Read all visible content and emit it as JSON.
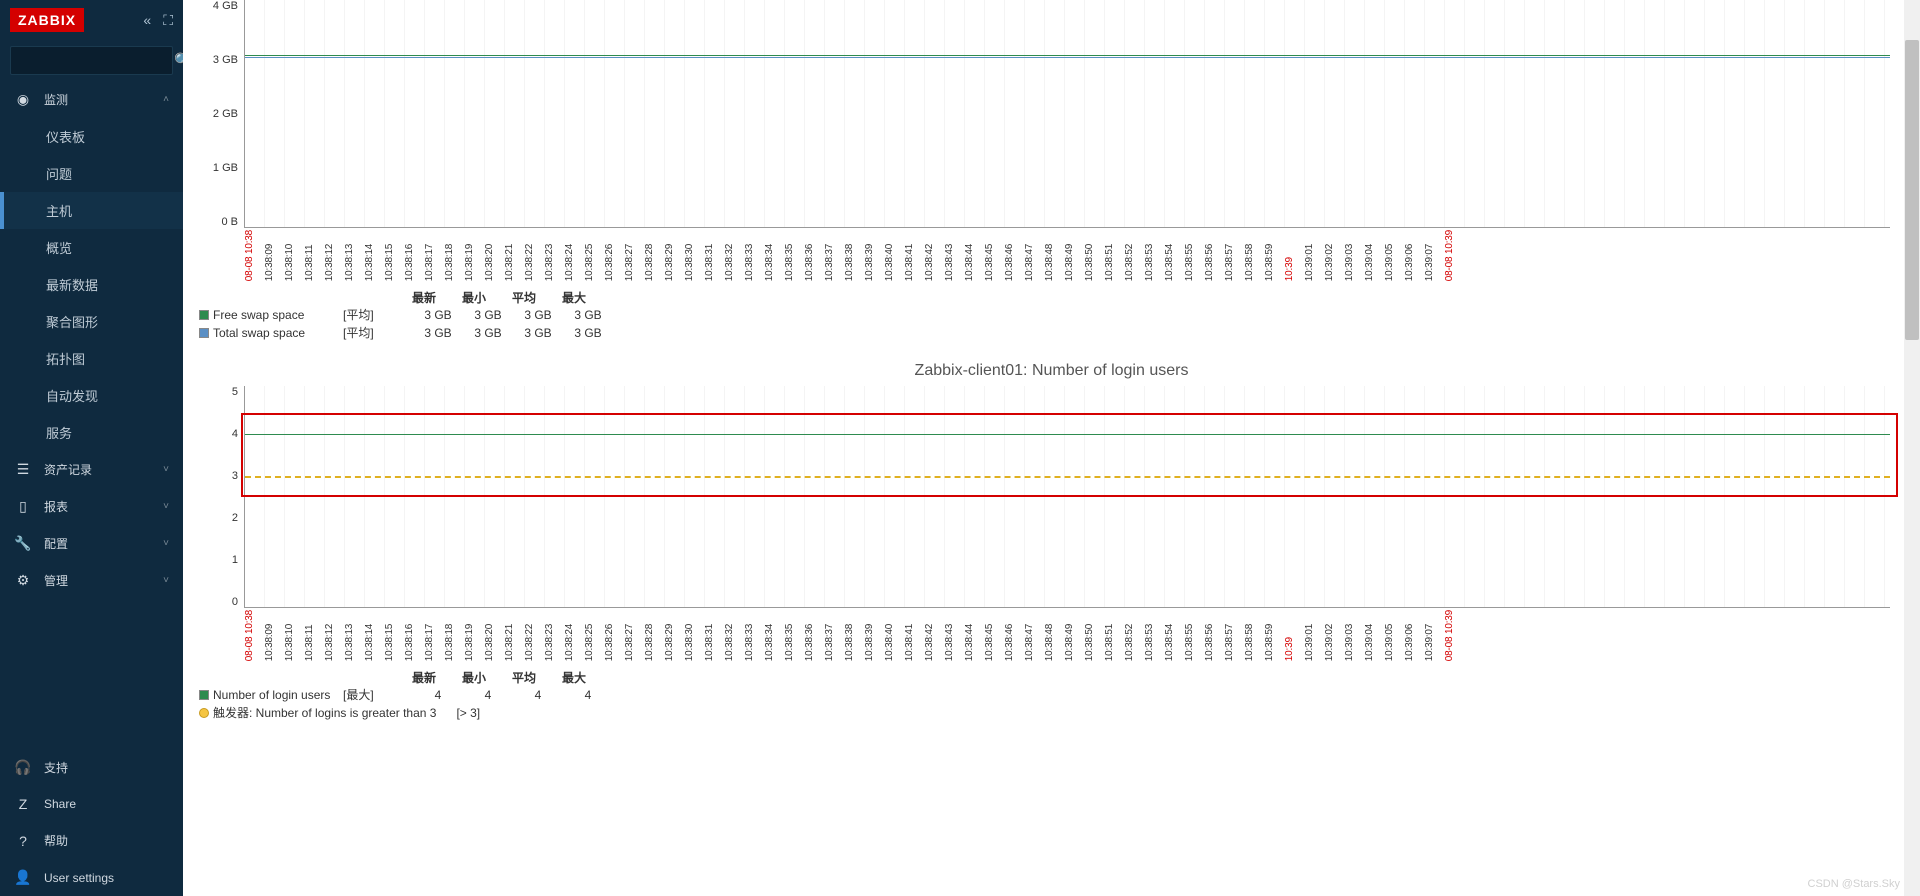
{
  "brand": "ZABBIX",
  "search": {
    "placeholder": ""
  },
  "sidebar": {
    "monitoring": {
      "label": "监测",
      "icon": "◉"
    },
    "sub": {
      "dashboard": "仪表板",
      "problems": "问题",
      "hosts": "主机",
      "overview": "概览",
      "latest_data": "最新数据",
      "graphs": "聚合图形",
      "maps": "拓扑图",
      "discovery": "自动发现",
      "services": "服务"
    },
    "inventory": {
      "label": "资产记录",
      "icon": "☰"
    },
    "reports": {
      "label": "报表",
      "icon": "▯"
    },
    "configuration": {
      "label": "配置",
      "icon": "🔧"
    },
    "administration": {
      "label": "管理",
      "icon": "⚙"
    },
    "support": {
      "label": "支持",
      "icon": "🎧"
    },
    "share": {
      "label": "Share",
      "icon": "Z"
    },
    "help": {
      "label": "帮助",
      "icon": "?"
    },
    "user_settings": {
      "label": "User settings",
      "icon": "👤"
    }
  },
  "chart1": {
    "y_labels": [
      "4 GB",
      "3 GB",
      "2 GB",
      "1 GB",
      "0 B"
    ],
    "line1_color": "#2e8b4f",
    "line2_color": "#5a8fc4",
    "legend_headers": {
      "latest": "最新",
      "min": "最小",
      "avg": "平均",
      "max": "最大"
    },
    "series": [
      {
        "name": "Free swap space",
        "agg": "[平均]",
        "swatch": "#2e8b4f",
        "latest": "3 GB",
        "min": "3 GB",
        "avg": "3 GB",
        "max": "3 GB"
      },
      {
        "name": "Total swap space",
        "agg": "[平均]",
        "swatch": "#5a8fc4",
        "latest": "3 GB",
        "min": "3 GB",
        "avg": "3 GB",
        "max": "3 GB"
      }
    ]
  },
  "chart2": {
    "title": "Zabbix-client01: Number of login users",
    "y_labels": [
      "5",
      "4",
      "3",
      "2",
      "1",
      "0"
    ],
    "line_color": "#2e8b4f",
    "trigger_color": "#f5c542",
    "legend_headers": {
      "latest": "最新",
      "min": "最小",
      "avg": "平均",
      "max": "最大"
    },
    "series": [
      {
        "name": "Number of login users",
        "agg": "[最大]",
        "swatch": "#2e8b4f",
        "latest": "4",
        "min": "4",
        "avg": "4",
        "max": "4"
      }
    ],
    "trigger_text": "触发器: Number of logins is greater than 3",
    "trigger_filter": "[> 3]"
  },
  "x_ticks": [
    {
      "label": "08-08 10:38",
      "red": true
    },
    {
      "label": "10:38:09"
    },
    {
      "label": "10:38:10"
    },
    {
      "label": "10:38:11"
    },
    {
      "label": "10:38:12"
    },
    {
      "label": "10:38:13"
    },
    {
      "label": "10:38:14"
    },
    {
      "label": "10:38:15"
    },
    {
      "label": "10:38:16"
    },
    {
      "label": "10:38:17"
    },
    {
      "label": "10:38:18"
    },
    {
      "label": "10:38:19"
    },
    {
      "label": "10:38:20"
    },
    {
      "label": "10:38:21"
    },
    {
      "label": "10:38:22"
    },
    {
      "label": "10:38:23"
    },
    {
      "label": "10:38:24"
    },
    {
      "label": "10:38:25"
    },
    {
      "label": "10:38:26"
    },
    {
      "label": "10:38:27"
    },
    {
      "label": "10:38:28"
    },
    {
      "label": "10:38:29"
    },
    {
      "label": "10:38:30"
    },
    {
      "label": "10:38:31"
    },
    {
      "label": "10:38:32"
    },
    {
      "label": "10:38:33"
    },
    {
      "label": "10:38:34"
    },
    {
      "label": "10:38:35"
    },
    {
      "label": "10:38:36"
    },
    {
      "label": "10:38:37"
    },
    {
      "label": "10:38:38"
    },
    {
      "label": "10:38:39"
    },
    {
      "label": "10:38:40"
    },
    {
      "label": "10:38:41"
    },
    {
      "label": "10:38:42"
    },
    {
      "label": "10:38:43"
    },
    {
      "label": "10:38:44"
    },
    {
      "label": "10:38:45"
    },
    {
      "label": "10:38:46"
    },
    {
      "label": "10:38:47"
    },
    {
      "label": "10:38:48"
    },
    {
      "label": "10:38:49"
    },
    {
      "label": "10:38:50"
    },
    {
      "label": "10:38:51"
    },
    {
      "label": "10:38:52"
    },
    {
      "label": "10:38:53"
    },
    {
      "label": "10:38:54"
    },
    {
      "label": "10:38:55"
    },
    {
      "label": "10:38:56"
    },
    {
      "label": "10:38:57"
    },
    {
      "label": "10:38:58"
    },
    {
      "label": "10:38:59"
    },
    {
      "label": "10:39",
      "red": true
    },
    {
      "label": "10:39:01"
    },
    {
      "label": "10:39:02"
    },
    {
      "label": "10:39:03"
    },
    {
      "label": "10:39:04"
    },
    {
      "label": "10:39:05"
    },
    {
      "label": "10:39:06"
    },
    {
      "label": "10:39:07"
    },
    {
      "label": "08-08 10:39",
      "red": true
    }
  ],
  "watermark": "CSDN @Stars.Sky",
  "chart_data": [
    {
      "type": "line",
      "title": "Swap space",
      "x": [
        "10:38:09",
        "10:38:10",
        "10:38:11",
        "10:38:12",
        "10:38:13",
        "10:38:14",
        "10:38:15",
        "10:38:16",
        "10:38:17",
        "10:38:18",
        "10:38:19",
        "10:38:20",
        "10:38:21",
        "10:38:22",
        "10:38:23",
        "10:38:24",
        "10:38:25",
        "10:38:26",
        "10:38:27",
        "10:38:28",
        "10:38:29",
        "10:38:30",
        "10:38:31",
        "10:38:32",
        "10:38:33",
        "10:38:34",
        "10:38:35",
        "10:38:36",
        "10:38:37",
        "10:38:38",
        "10:38:39",
        "10:38:40",
        "10:38:41",
        "10:38:42",
        "10:38:43",
        "10:38:44",
        "10:38:45",
        "10:38:46",
        "10:38:47",
        "10:38:48",
        "10:38:49",
        "10:38:50",
        "10:38:51",
        "10:38:52",
        "10:38:53",
        "10:38:54",
        "10:38:55",
        "10:38:56",
        "10:38:57",
        "10:38:58",
        "10:38:59",
        "10:39:00",
        "10:39:01",
        "10:39:02",
        "10:39:03",
        "10:39:04",
        "10:39:05",
        "10:39:06",
        "10:39:07"
      ],
      "series": [
        {
          "name": "Free swap space",
          "agg": "avg",
          "values_gb": 3,
          "constant": true,
          "latest": 3,
          "min": 3,
          "avg": 3,
          "max": 3
        },
        {
          "name": "Total swap space",
          "agg": "avg",
          "values_gb": 3,
          "constant": true,
          "latest": 3,
          "min": 3,
          "avg": 3,
          "max": 3
        }
      ],
      "ylabel": "",
      "xlabel": "",
      "y_unit": "GB",
      "ylim": [
        0,
        4.5
      ],
      "y_ticks": [
        0,
        1,
        2,
        3,
        4
      ],
      "y_tick_labels": [
        "0 B",
        "1 GB",
        "2 GB",
        "3 GB",
        "4 GB"
      ]
    },
    {
      "type": "line",
      "title": "Zabbix-client01: Number of login users",
      "x": [
        "10:38:09",
        "10:38:10",
        "10:38:11",
        "10:38:12",
        "10:38:13",
        "10:38:14",
        "10:38:15",
        "10:38:16",
        "10:38:17",
        "10:38:18",
        "10:38:19",
        "10:38:20",
        "10:38:21",
        "10:38:22",
        "10:38:23",
        "10:38:24",
        "10:38:25",
        "10:38:26",
        "10:38:27",
        "10:38:28",
        "10:38:29",
        "10:38:30",
        "10:38:31",
        "10:38:32",
        "10:38:33",
        "10:38:34",
        "10:38:35",
        "10:38:36",
        "10:38:37",
        "10:38:38",
        "10:38:39",
        "10:38:40",
        "10:38:41",
        "10:38:42",
        "10:38:43",
        "10:38:44",
        "10:38:45",
        "10:38:46",
        "10:38:47",
        "10:38:48",
        "10:38:49",
        "10:38:50",
        "10:38:51",
        "10:38:52",
        "10:38:53",
        "10:38:54",
        "10:38:55",
        "10:38:56",
        "10:38:57",
        "10:38:58",
        "10:38:59",
        "10:39:00",
        "10:39:01",
        "10:39:02",
        "10:39:03",
        "10:39:04",
        "10:39:05",
        "10:39:06",
        "10:39:07"
      ],
      "series": [
        {
          "name": "Number of login users",
          "agg": "max",
          "values": 4,
          "constant": true,
          "latest": 4,
          "min": 4,
          "avg": 4,
          "max": 4
        }
      ],
      "triggers": [
        {
          "name": "Number of logins is greater than 3",
          "threshold": 3,
          "op": ">"
        }
      ],
      "ylabel": "",
      "xlabel": "",
      "ylim": [
        0,
        5.2
      ],
      "y_ticks": [
        0,
        1,
        2,
        3,
        4,
        5
      ]
    }
  ]
}
